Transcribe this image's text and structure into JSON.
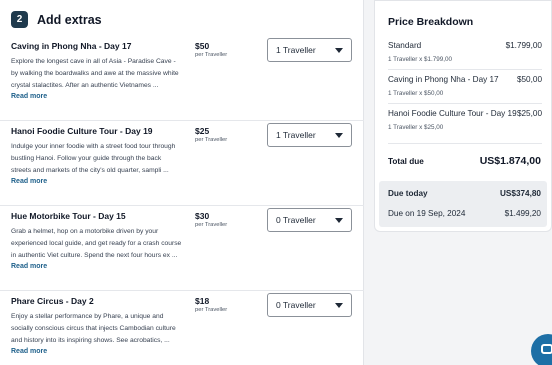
{
  "extras": {
    "step_number": "2",
    "title": "Add extras",
    "items": [
      {
        "name": "Caving in Phong Nha - Day 17",
        "description_lines": [
          "Explore the longest cave in all of Asia - Paradise Cave -",
          "by walking the boardwalks and awe at the massive white",
          "crystal stalactites. After an authentic Vietnames ..."
        ],
        "read_more": "Read more",
        "price": "$50",
        "per_label": "per Traveller",
        "selected": "1 Traveller"
      },
      {
        "name": "Hanoi Foodie Culture Tour - Day 19",
        "description_lines": [
          "Indulge your inner foodie with a street food tour through",
          "bustling Hanoi. Follow your guide through the back",
          "streets and markets of the city's old quarter, sampli ..."
        ],
        "read_more": "Read more",
        "price": "$25",
        "per_label": "per Traveller",
        "selected": "1 Traveller"
      },
      {
        "name": "Hue Motorbike Tour - Day 15",
        "description_lines": [
          "Grab a helmet, hop on a motorbike driven by your",
          "experienced local guide, and get ready for a crash course",
          "in authentic Viet culture. Spend the next four hours ex ..."
        ],
        "read_more": "Read more",
        "price": "$30",
        "per_label": "per Traveller",
        "selected": "0 Traveller"
      },
      {
        "name": "Phare Circus - Day 2",
        "description_lines": [
          "Enjoy a stellar performance by Phare, a unique and",
          "socially conscious circus that injects Cambodian culture",
          "and history into its inspiring shows. See acrobatics, ..."
        ],
        "read_more": "Read more",
        "price": "$18",
        "per_label": "per Traveller",
        "selected": "0 Traveller"
      }
    ]
  },
  "price_breakdown": {
    "title": "Price Breakdown",
    "lines": [
      {
        "name": "Standard",
        "amount": "$1.799,00",
        "detail": "1 Traveller x $1.799,00"
      },
      {
        "name": "Caving in Phong Nha - Day 17",
        "amount": "$50,00",
        "detail": "1 Traveller x $50,00"
      },
      {
        "name": "Hanoi Foodie Culture Tour - Day 19",
        "amount": "$25,00",
        "detail": "1 Traveller x $25,00"
      }
    ],
    "total_label": "Total due",
    "total_amount": "US$1.874,00",
    "due_today_label": "Due today",
    "due_today_amount": "US$374,80",
    "due_later_label": "Due on 19 Sep, 2024",
    "due_later_amount": "$1.499,20"
  },
  "colors": {
    "badge": "#1f3a4d",
    "link": "#1d5f8a",
    "chat_button": "#1d6fa6"
  },
  "icons": {
    "select_arrow": "chevron-down-icon",
    "chat": "chat-icon"
  }
}
